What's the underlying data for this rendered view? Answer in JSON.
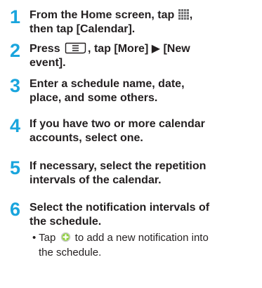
{
  "steps": [
    {
      "number": "1",
      "line1_before_icon": "From the Home screen, tap ",
      "icon": "app-grid-icon",
      "line1_after_icon": ",",
      "line2": "then tap [Calendar]."
    },
    {
      "number": "2",
      "line1_before_key": "Press ",
      "key": "menu-key-icon",
      "line1_after_key": ", tap [More] ▶ [New",
      "line2": "event]."
    },
    {
      "number": "3",
      "line1": "Enter a schedule name, date,",
      "line2": "place, and some others."
    },
    {
      "number": "4",
      "line1": "If you have two or more calendar",
      "line2": "accounts, select one."
    },
    {
      "number": "5",
      "line1": "If necessary, select the repetition",
      "line2": "intervals of the calendar."
    },
    {
      "number": "6",
      "line1": "Select the notification intervals of",
      "line2": "the schedule.",
      "note_before_icon": "• Tap ",
      "note_icon": "add-notification-icon",
      "note_after_icon": " to add a new notification into",
      "note_line2": "the schedule."
    }
  ],
  "colors": {
    "step_number": "#1aa5dd",
    "text": "#231f20"
  }
}
